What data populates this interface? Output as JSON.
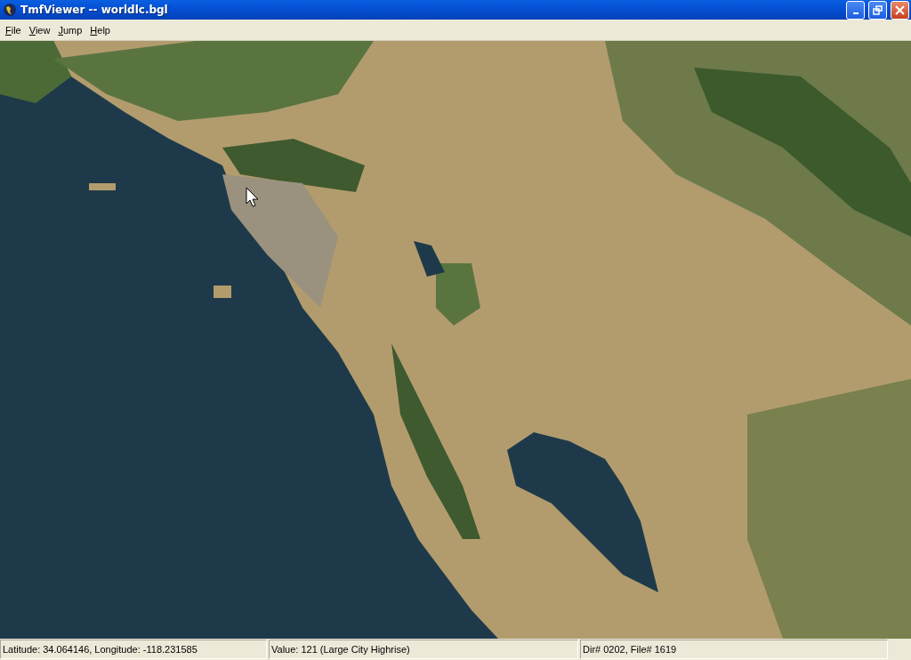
{
  "window": {
    "title": "TmfViewer -- worldlc.bgl"
  },
  "menu": [
    "File",
    "View",
    "Jump",
    "Help"
  ],
  "status_bar": [
    "Latitude: 34.064146, Longitude: -118.231585",
    "Value: 121 (Large City Highrise)",
    "Dir# 0202, File# 1619"
  ]
}
